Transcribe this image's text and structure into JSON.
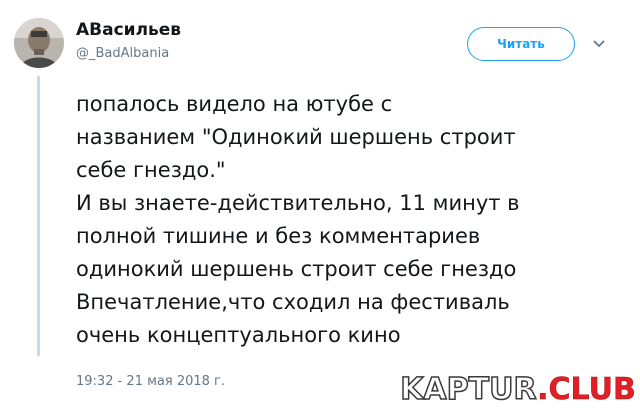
{
  "tweet": {
    "display_name": "АВасильев",
    "handle": "@_BadAlbania",
    "follow_label": "Читать",
    "text_lines": [
      "попалось видело на ютубе с",
      "названием \"Одинокий шершень строит",
      "себе гнездо.\"",
      "И вы знаете-действительно, 11 минут в",
      "полной тишине и без комментариев",
      "одинокий шершень строит себе гнездо",
      "Впечатление,что сходил на фестиваль",
      "очень концептуального кино"
    ],
    "timestamp": "19:32 - 21 мая 2018 г."
  },
  "watermark": {
    "part1": "KAPTUR",
    "part2": ".CLUB"
  },
  "icons": {
    "avatar": "user-avatar-photo",
    "menu": "chevron-down-icon"
  },
  "colors": {
    "accent": "#1da1f2",
    "thread_line": "#c3dbec",
    "muted_text": "#657786",
    "watermark_red": "#e31e24"
  }
}
